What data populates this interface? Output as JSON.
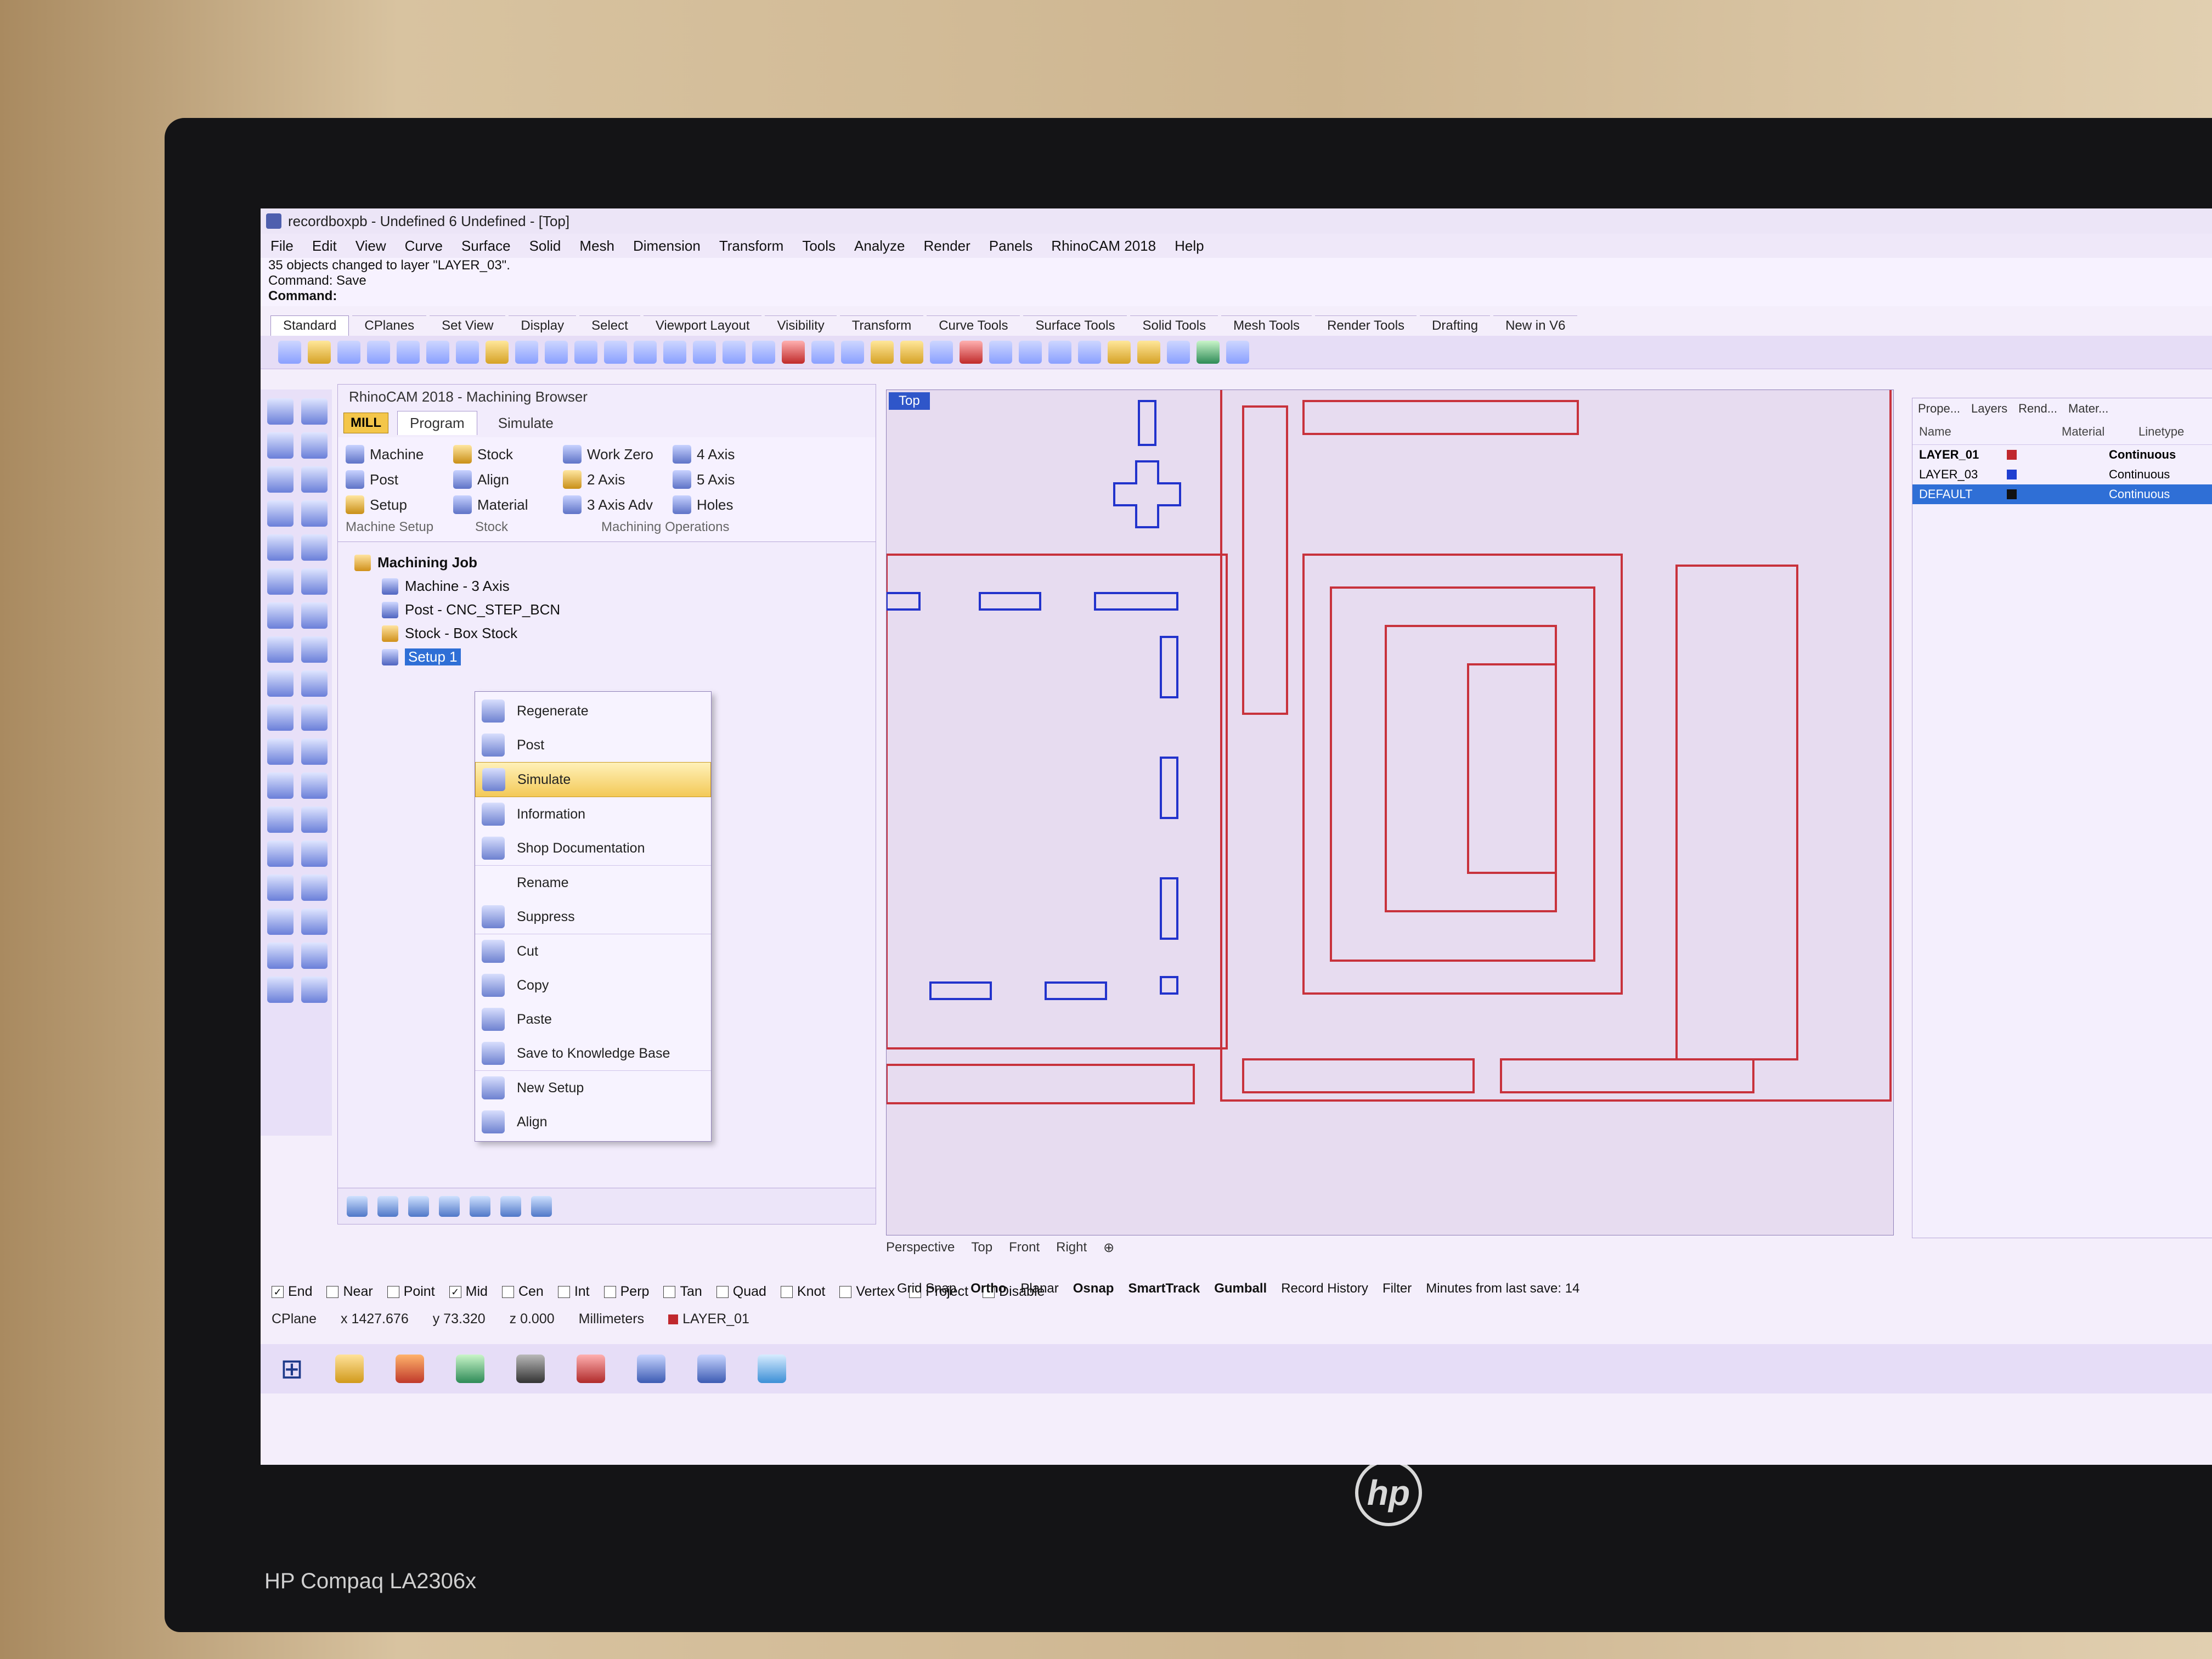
{
  "window": {
    "title": "recordboxpb - Undefined 6 Undefined - [Top]"
  },
  "menu": [
    "File",
    "Edit",
    "View",
    "Curve",
    "Surface",
    "Solid",
    "Mesh",
    "Dimension",
    "Transform",
    "Tools",
    "Analyze",
    "Render",
    "Panels",
    "RhinoCAM 2018",
    "Help"
  ],
  "command": {
    "history": "35 objects changed to layer \"LAYER_03\".",
    "last_label": "Command:",
    "last_value": "Save",
    "prompt": "Command:"
  },
  "toolbar_tabs": [
    "Standard",
    "CPlanes",
    "Set View",
    "Display",
    "Select",
    "Viewport Layout",
    "Visibility",
    "Transform",
    "Curve Tools",
    "Surface Tools",
    "Solid Tools",
    "Mesh Tools",
    "Render Tools",
    "Drafting",
    "New in V6"
  ],
  "browser": {
    "title": "RhinoCAM 2018 - Machining Browser",
    "mode": "MILL",
    "tabs": [
      "Program",
      "Simulate"
    ],
    "ribbon": {
      "machine": "Machine",
      "post": "Post",
      "setup": "Setup",
      "stock": "Stock",
      "align": "Align",
      "material": "Material",
      "work_zero": "Work Zero",
      "axis2": "2 Axis",
      "axis3adv": "3 Axis Adv",
      "axis4": "4 Axis",
      "axis5": "5 Axis",
      "holes": "Holes",
      "group_machine_setup": "Machine Setup",
      "group_stock": "Stock",
      "group_ops": "Machining Operations"
    },
    "tree": {
      "root": "Machining Job",
      "machine": "Machine - 3 Axis",
      "post": "Post - CNC_STEP_BCN",
      "stock": "Stock - Box Stock",
      "setup": "Setup 1"
    }
  },
  "context_menu": [
    "Regenerate",
    "Post",
    "Simulate",
    "Information",
    "Shop Documentation",
    "Rename",
    "Suppress",
    "Cut",
    "Copy",
    "Paste",
    "Save to Knowledge Base",
    "New Setup",
    "Align"
  ],
  "viewport": {
    "label": "Top",
    "tabs": [
      "Perspective",
      "Top",
      "Front",
      "Right"
    ]
  },
  "layers_panel": {
    "tabs": [
      "Prope...",
      "Layers",
      "Rend...",
      "Mater..."
    ],
    "columns": [
      "Name",
      "Material",
      "Linetype"
    ],
    "rows": [
      {
        "name": "LAYER_01",
        "color": "#c0282d",
        "linetype": "Continuous"
      },
      {
        "name": "LAYER_03",
        "color": "#1f3fd1",
        "linetype": "Continuous"
      },
      {
        "name": "DEFAULT",
        "color": "#111111",
        "linetype": "Continuous"
      }
    ]
  },
  "osnaps": [
    {
      "label": "End",
      "checked": true
    },
    {
      "label": "Near",
      "checked": false
    },
    {
      "label": "Point",
      "checked": false
    },
    {
      "label": "Mid",
      "checked": true
    },
    {
      "label": "Cen",
      "checked": false
    },
    {
      "label": "Int",
      "checked": false
    },
    {
      "label": "Perp",
      "checked": false
    },
    {
      "label": "Tan",
      "checked": false
    },
    {
      "label": "Quad",
      "checked": false
    },
    {
      "label": "Knot",
      "checked": false
    },
    {
      "label": "Vertex",
      "checked": false
    },
    {
      "label": "Project",
      "checked": false
    },
    {
      "label": "Disable",
      "checked": false
    }
  ],
  "status": {
    "cplane": "CPlane",
    "x": "x 1427.676",
    "y": "y 73.320",
    "z": "z 0.000",
    "units": "Millimeters",
    "layer": "LAYER_01",
    "grid_snap": "Grid Snap",
    "ortho": "Ortho",
    "planar": "Planar",
    "osnap": "Osnap",
    "smarttrack": "SmartTrack",
    "gumball": "Gumball",
    "record_history": "Record History",
    "filter": "Filter",
    "autosave": "Minutes from last save: 14"
  },
  "bezel": {
    "model": "HP Compaq LA2306x",
    "logo_text": "hp"
  }
}
